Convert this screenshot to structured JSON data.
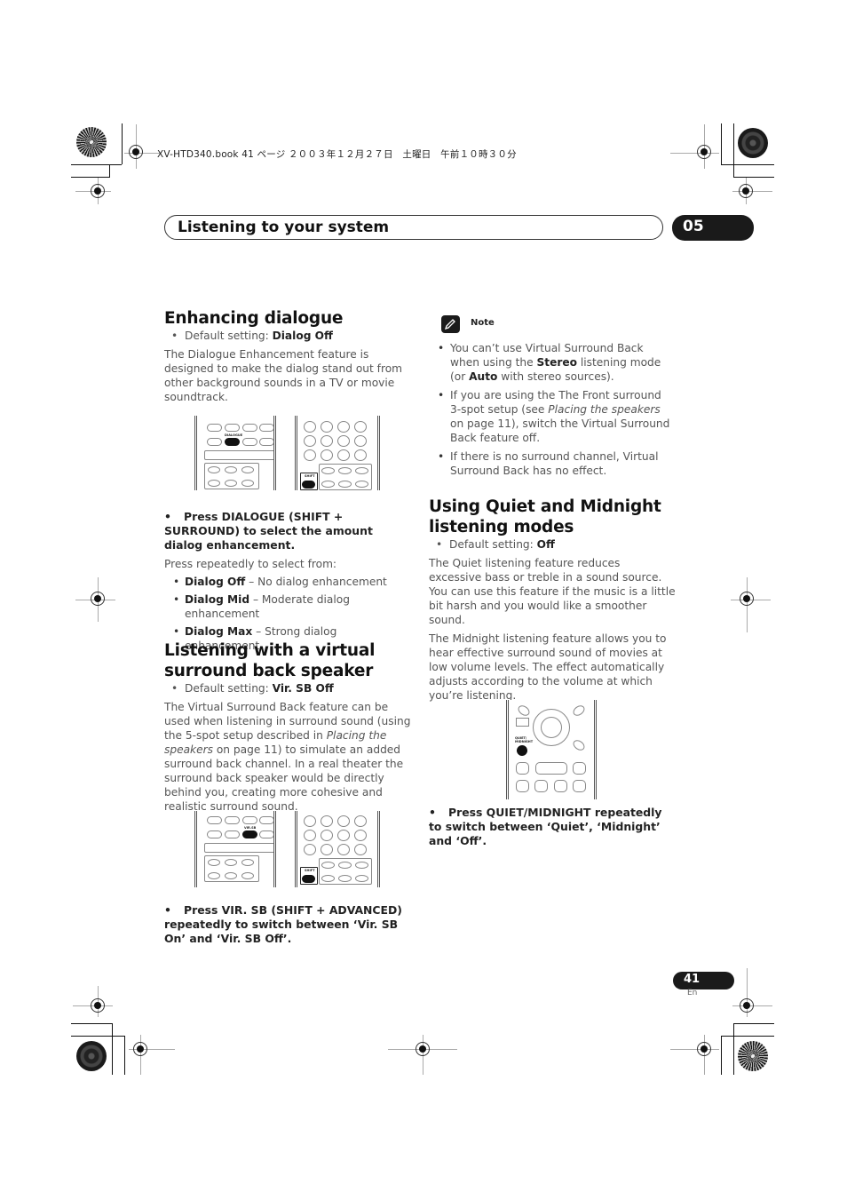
{
  "book_header": "XV-HTD340.book  41 ページ  ２００３年１２月２７日　土曜日　午前１０時３０分",
  "chapter": {
    "title": "Listening to your system",
    "number": "05"
  },
  "left_column": {
    "section1": {
      "heading": "Enhancing dialogue",
      "default_label": "Default setting: ",
      "default_value": "Dialog Off",
      "body": "The Dialogue Enhancement feature is designed to make the dialog stand out from other background sounds in a TV or movie soundtrack.",
      "remote_labels": {
        "dialogue": "DIALOGUE",
        "shift": "SHIFT"
      },
      "instruction": "Press DIALOGUE (SHIFT + SURROUND) to select the amount dialog enhancement.",
      "instruction_sub": "Press repeatedly to select from:",
      "options": [
        {
          "name": "Dialog Off",
          "desc": " – No dialog enhancement"
        },
        {
          "name": "Dialog Mid",
          "desc": " – Moderate dialog enhancement"
        },
        {
          "name": "Dialog Max",
          "desc": " – Strong dialog enhancement"
        }
      ]
    },
    "section2": {
      "heading": "Listening with a virtual surround back speaker",
      "default_label": "Default setting: ",
      "default_value": "Vir. SB Off",
      "body_part1": "The Virtual Surround Back feature can be used when listening in surround sound (using the 5-spot setup described in ",
      "body_italic": "Placing the speakers",
      "body_part2": " on page 11) to simulate an added surround back channel. In a real theater the surround back speaker would be directly behind you, creating more cohesive and realistic surround sound.",
      "remote_labels": {
        "vir_sb": "VIR.SB",
        "shift": "SHIFT"
      },
      "instruction": "Press VIR. SB (SHIFT + ADVANCED) repeatedly to switch between ‘Vir. SB On’ and ‘Vir. SB Off’."
    }
  },
  "right_column": {
    "note": {
      "title": "Note",
      "icon": "pencil-icon",
      "items": [
        {
          "p1": "You can’t use Virtual Surround Back when using the ",
          "b1": "Stereo",
          "p2": " listening mode (or ",
          "b2": "Auto",
          "p3": " with stereo sources)."
        },
        {
          "p1": "If you are using the The Front surround 3-spot setup (see ",
          "i1": "Placing the speakers",
          "p2": " on page 11), switch the  Virtual Surround Back feature off."
        },
        {
          "p1": "If there is no surround channel, Virtual Surround Back has no effect."
        }
      ]
    },
    "section3": {
      "heading": "Using Quiet and Midnight listening modes",
      "default_label": "Default setting: ",
      "default_value": "Off",
      "body1": "The Quiet listening feature reduces excessive bass or treble in a sound source. You can use this feature if the music is a little bit harsh and you would like a smoother sound.",
      "body2": "The Midnight listening feature allows you to hear effective surround sound of movies at low volume levels. The effect automatically adjusts according to the volume at which you’re listening.",
      "remote_labels": {
        "quiet": "QUIET/ MIDNIGHT"
      },
      "instruction": "Press QUIET/MIDNIGHT repeatedly to switch between ‘Quiet’, ‘Midnight’ and ‘Off’."
    }
  },
  "footer": {
    "page_number": "41",
    "language": "En"
  }
}
